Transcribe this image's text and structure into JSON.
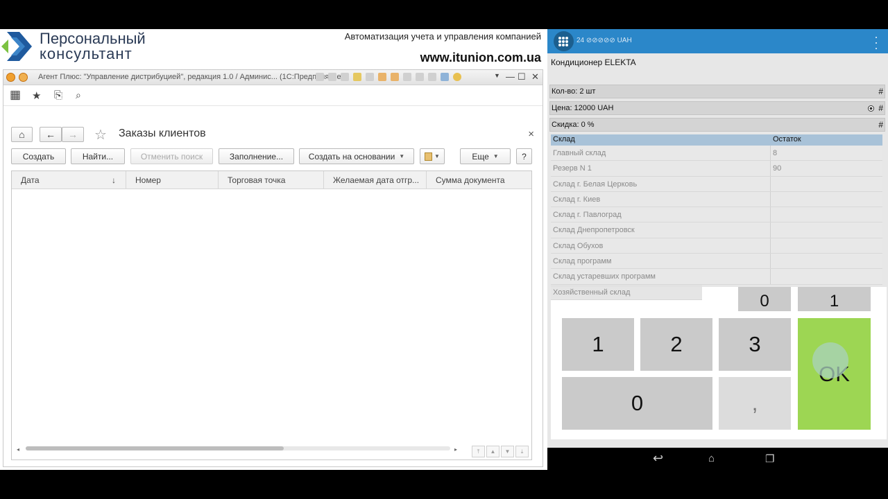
{
  "brand": {
    "name_line1": "Персональный",
    "name_line2": "консультант",
    "tagline": "Автоматизация учета и управления компанией",
    "url": "www.itunion.com.ua"
  },
  "desktop_window": {
    "title": "Агент Плюс: \"Управление дистрибуцией\", редакция 1.0 / Админис...  (1С:Предприятие)",
    "toolbar_icons": [
      "apps-grid-icon",
      "star-icon",
      "history-icon",
      "search-icon"
    ],
    "nav": {
      "home_icon": "home-icon",
      "back_icon": "arrow-left-icon",
      "forward_icon": "arrow-right-icon",
      "favorite_icon": "star-outline-icon",
      "form_title": "Заказы клиентов",
      "close": "×"
    },
    "commands": {
      "create": "Создать",
      "find": "Найти...",
      "cancel_search": "Отменить поиск",
      "fill": "Заполнение...",
      "create_based_on": "Создать на основании",
      "more": "Еще",
      "help": "?"
    },
    "table": {
      "columns": [
        "Дата",
        "Номер",
        "Торговая точка",
        "Желаемая дата отгр...",
        "Сумма документа"
      ],
      "sort_indicator": "↓",
      "rows": []
    }
  },
  "mobile_app": {
    "amount": "24 ⊘⊘⊘⊘⊘ UAH",
    "product_name": "Кондиционер ELEKTA",
    "quantity": "Кол-во: 2 шт",
    "price": "Цена: 12000 UAH",
    "discount": "Скидка: 0  %",
    "hash": "#",
    "stock": {
      "headers": [
        "Склад",
        "Остаток"
      ],
      "rows": [
        {
          "warehouse": "Главный склад",
          "balance": "8"
        },
        {
          "warehouse": "Резерв N 1",
          "balance": "90"
        },
        {
          "warehouse": "Склад г. Белая Церковь",
          "balance": ""
        },
        {
          "warehouse": "Склад г. Киев",
          "balance": ""
        },
        {
          "warehouse": "Склад г. Павлоград",
          "balance": ""
        },
        {
          "warehouse": "Склад Днепропетровск",
          "balance": ""
        },
        {
          "warehouse": "Склад Обухов",
          "balance": ""
        },
        {
          "warehouse": "Склад программ",
          "balance": ""
        },
        {
          "warehouse": "Склад устаревших программ",
          "balance": ""
        },
        {
          "warehouse": "Хозяйственный склад",
          "balance": ""
        }
      ]
    },
    "keypad": {
      "k1": "1",
      "k2": "2",
      "k3": "3",
      "k0": "0",
      "comma": ",",
      "ok": "OK",
      "partial_top_left": "0",
      "partial_top_right": "1"
    },
    "system_nav": [
      "back-icon",
      "home-icon",
      "recents-icon"
    ]
  }
}
